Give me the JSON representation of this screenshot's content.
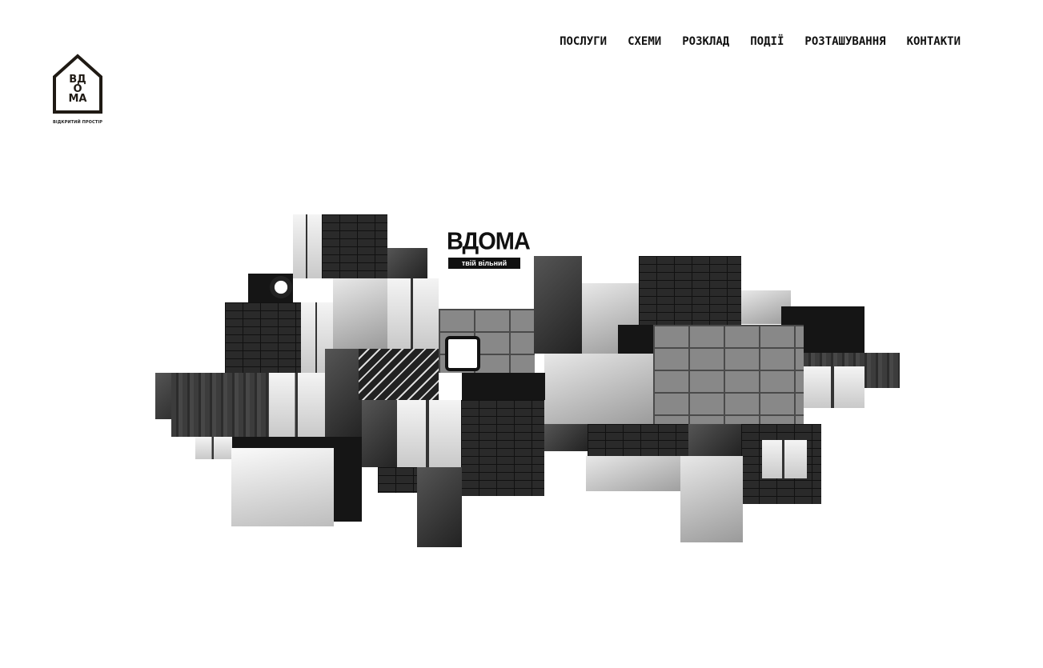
{
  "logo": {
    "letters": [
      "ВД",
      "О",
      "МА"
    ],
    "caption": "ВІДКРИТИЙ ПРОСТІР",
    "stroke_color": "#1f1a14"
  },
  "nav": {
    "items": [
      {
        "label": "ПОСЛУГИ"
      },
      {
        "label": "СХЕМИ"
      },
      {
        "label": "РОЗКЛАД"
      },
      {
        "label": "ПОДІЇ"
      },
      {
        "label": "РОЗТАШУВАННЯ"
      },
      {
        "label": "КОНТАКТИ"
      }
    ]
  },
  "hero": {
    "brand_title": "ВДОМА",
    "brand_subtitle": "твій вільний простір"
  }
}
